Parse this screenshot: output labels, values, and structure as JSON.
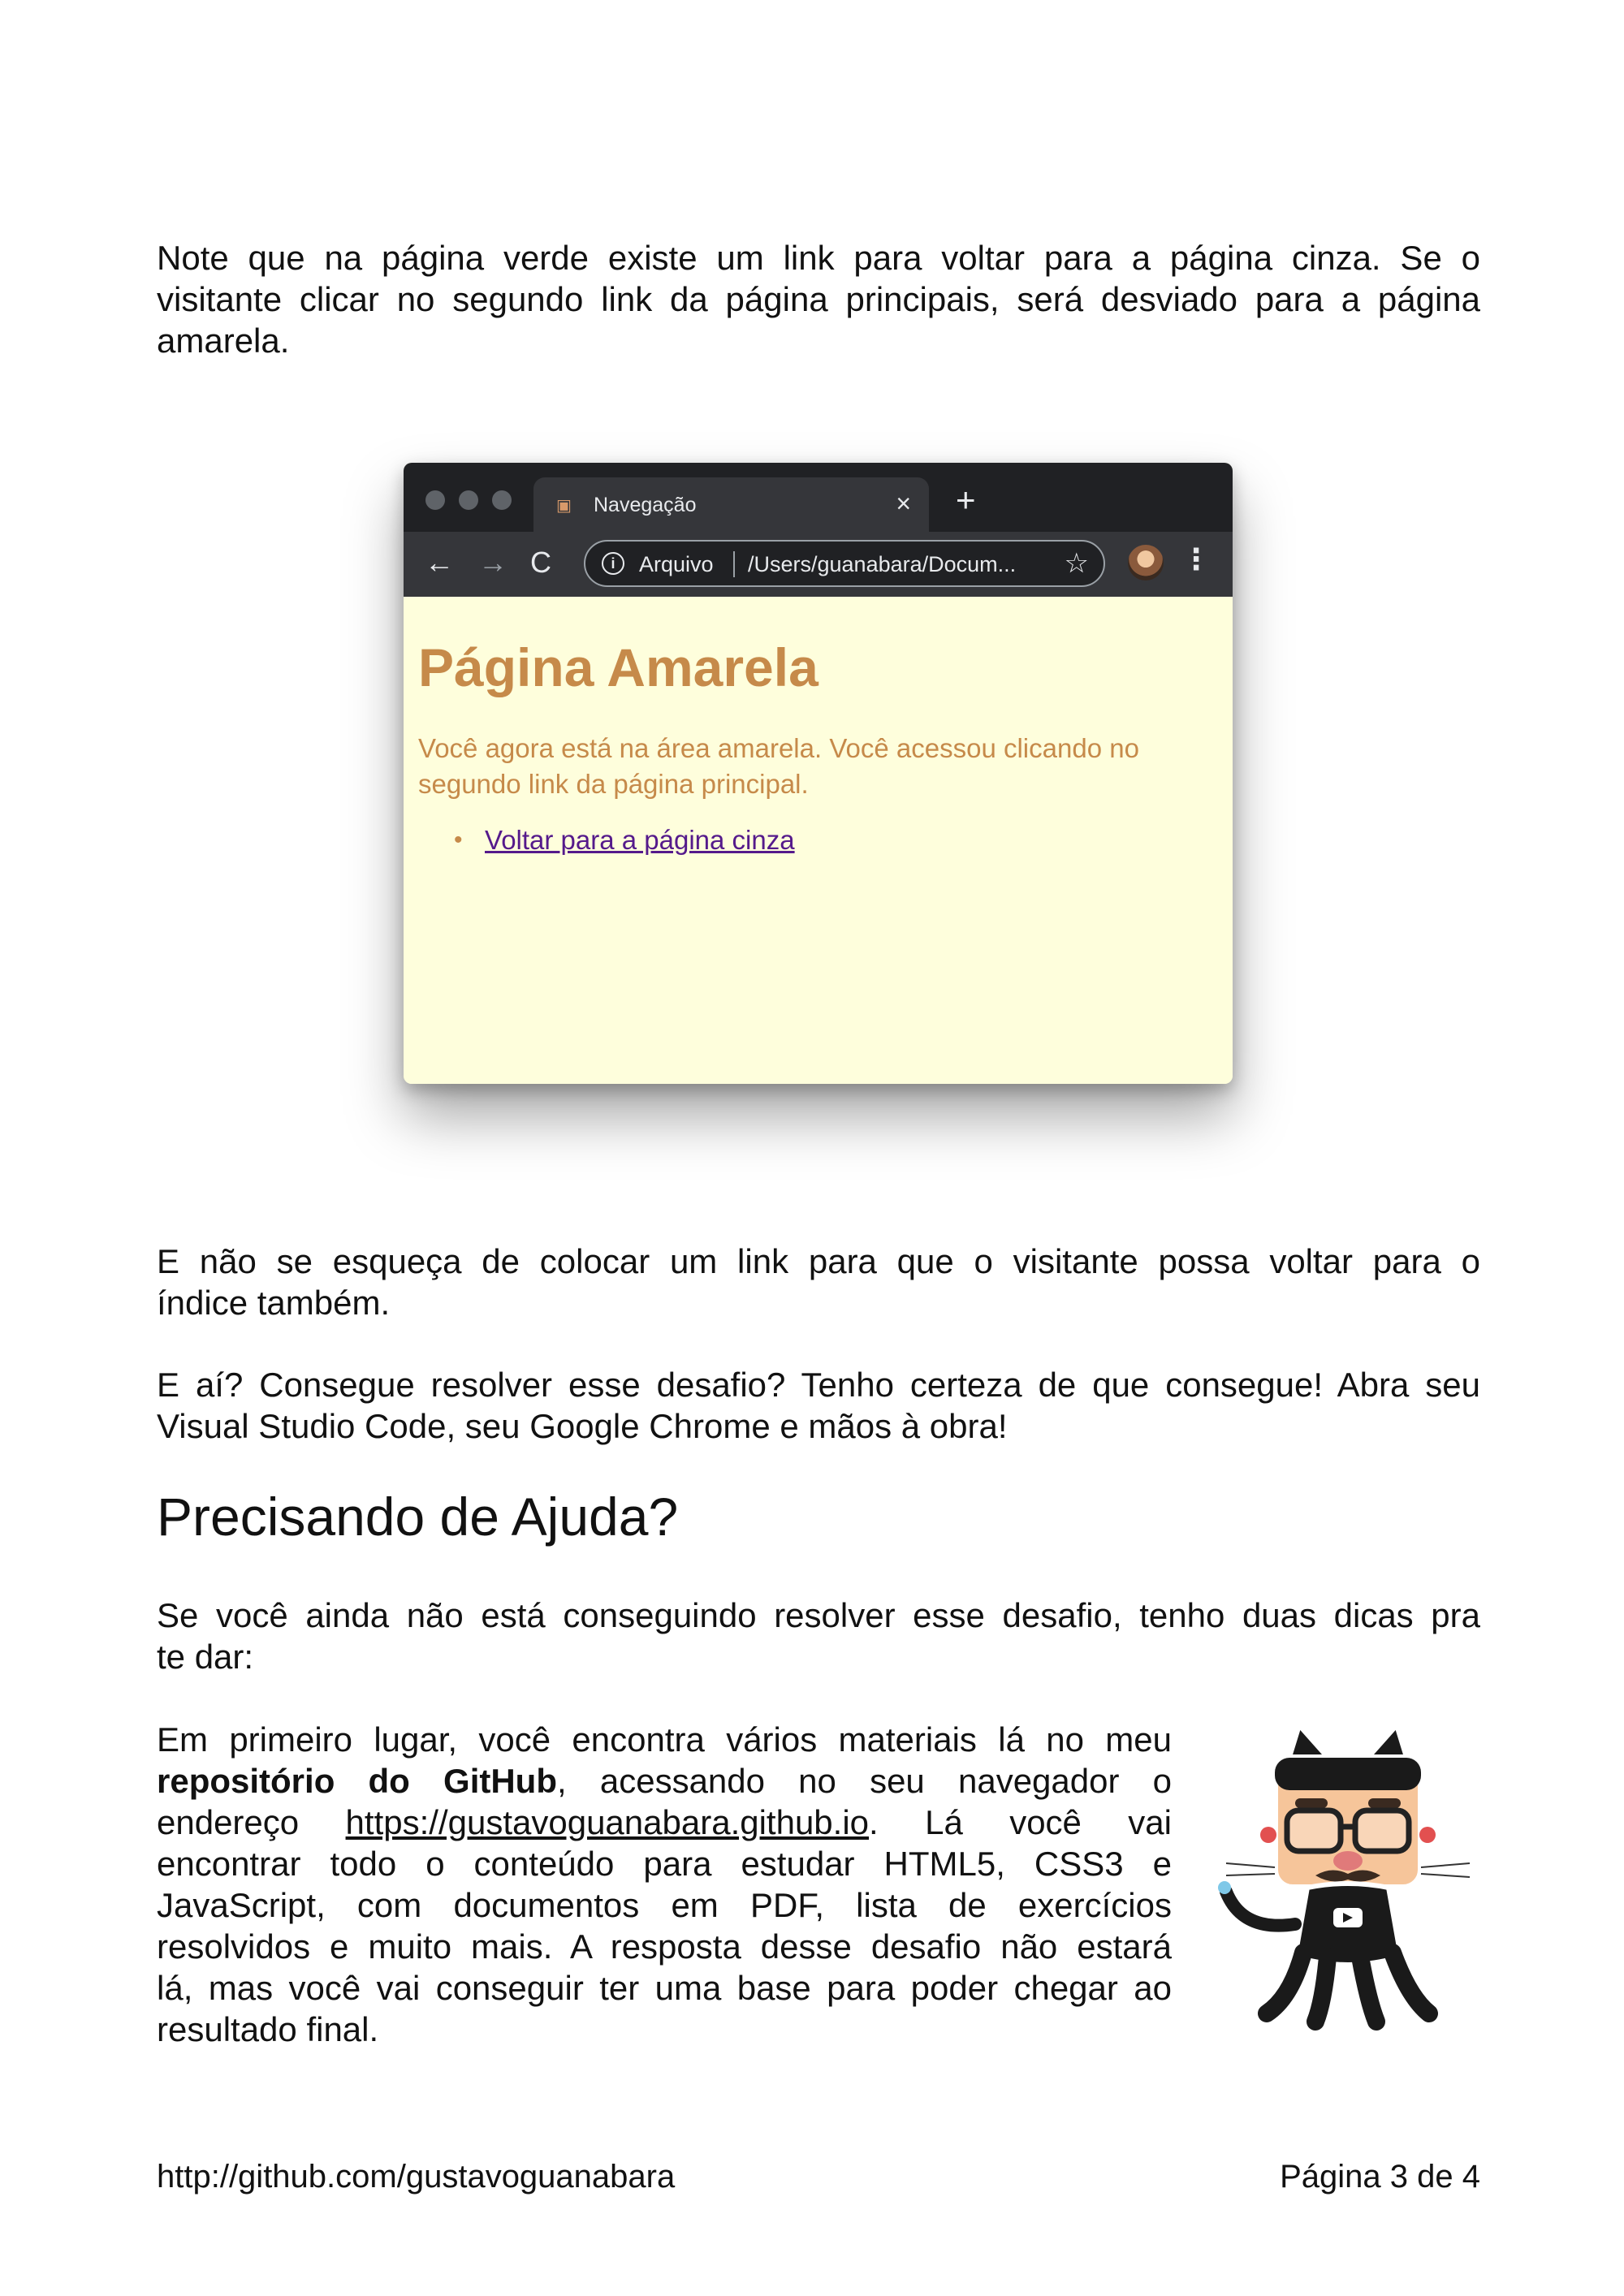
{
  "intro": {
    "line1": "Note que na página verde existe um link para voltar para a página cinza. Se o",
    "line2": "visitante clicar no segundo link da página principais, será desviado para a página",
    "line3": "amarela."
  },
  "browser": {
    "tab_title": "Navegação",
    "tab_favicon": "favicon-icon",
    "close_symbol": "×",
    "new_tab_symbol": "+",
    "back_symbol": "←",
    "forward_symbol": "→",
    "reload_symbol": "C",
    "info_symbol": "i",
    "omnibox_label": "Arquivo",
    "omnibox_url": "/Users/guanabara/Docum...",
    "star_symbol": "☆",
    "menu_symbol": "⋮",
    "page": {
      "heading": "Página Amarela",
      "paragraph": "Você agora está na área amarela. Você acessou clicando no segundo link da página principal.",
      "bullet": "•",
      "link": "Voltar para a página cinza",
      "background": "#fefedc",
      "text_color": "#c68a4a",
      "link_color": "#551a8b"
    }
  },
  "para2": {
    "line1": "E não se esqueça de colocar um link para que o visitante possa voltar para o",
    "line2": "índice também."
  },
  "para3": {
    "line1": "E aí? Consegue resolver esse desafio? Tenho certeza de que consegue! Abra seu",
    "line2": "Visual Studio Code, seu Google Chrome e mãos à obra!"
  },
  "heading": "Precisando de Ajuda?",
  "para4": {
    "line1": "Se você ainda não está conseguindo resolver esse desafio, tenho duas dicas pra",
    "line2": "te dar:"
  },
  "para5": {
    "line1": "Em primeiro lugar, você encontra vários materiais lá no meu",
    "bold": "repositório do GitHub",
    "after_bold": ", acessando no seu navegador o",
    "prefix3": "endereço",
    "link": "https://gustavoguanabara.github.io",
    "after_link": ". Lá você vai",
    "line4": "encontrar todo o conteúdo para estudar HTML5, CSS3 e",
    "line5": "JavaScript, com documentos em PDF, lista de exercícios",
    "line6": "resolvidos e muito mais. A resposta desse desafio não estará",
    "line7": "lá, mas você vai conseguir ter uma base para poder chegar ao",
    "line8": "resultado final."
  },
  "footer": {
    "left": "http://github.com/gustavoguanabara",
    "right": "Página 3 de 4"
  },
  "mascot": "octocat-mascot-icon"
}
